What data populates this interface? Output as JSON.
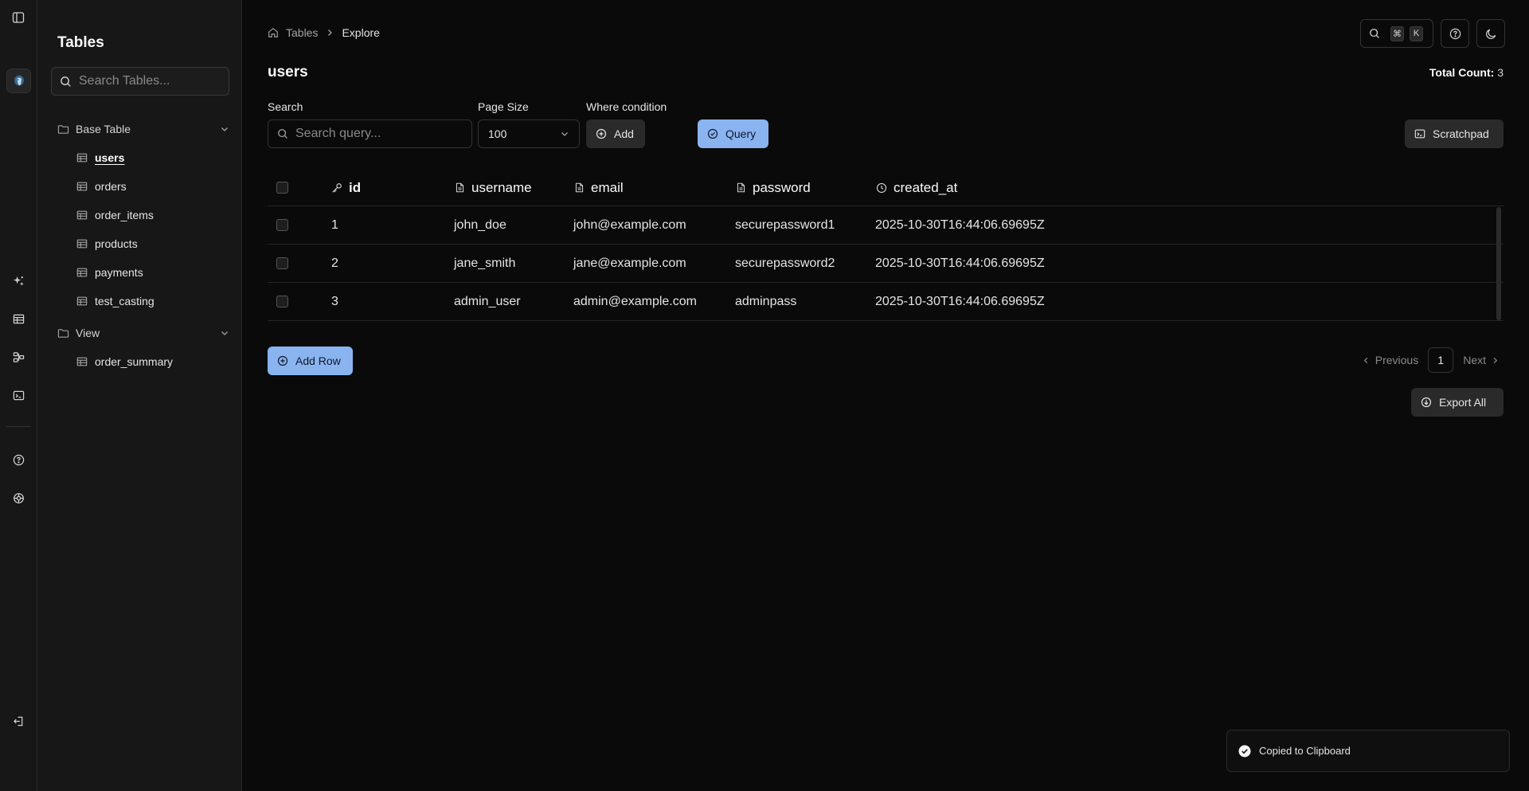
{
  "rail": {
    "icons": [
      "sidebar-toggle-icon",
      "database-logo",
      "sparkles-icon",
      "table-icon",
      "schema-icon",
      "terminal-icon",
      "help-icon",
      "settings-icon",
      "logout-icon"
    ]
  },
  "sidebar": {
    "title": "Tables",
    "search_placeholder": "Search Tables...",
    "groups": [
      {
        "label": "Base Table",
        "items": [
          "users",
          "orders",
          "order_items",
          "products",
          "payments",
          "test_casting"
        ]
      },
      {
        "label": "View",
        "items": [
          "order_summary"
        ]
      }
    ],
    "active_item": "users"
  },
  "breadcrumb": {
    "home": "Tables",
    "current": "Explore"
  },
  "header": {
    "shortcut_keys": [
      "⌘",
      "K"
    ],
    "page_title": "users",
    "total_label": "Total Count:",
    "total_value": "3"
  },
  "filters": {
    "search_label": "Search",
    "search_placeholder": "Search query...",
    "page_size_label": "Page Size",
    "page_size_value": "100",
    "where_label": "Where condition",
    "add_label": "Add",
    "query_label": "Query",
    "scratchpad_label": "Scratchpad"
  },
  "table": {
    "columns": [
      {
        "name": "id",
        "icon": "key-icon"
      },
      {
        "name": "username",
        "icon": "file-icon"
      },
      {
        "name": "email",
        "icon": "file-icon"
      },
      {
        "name": "password",
        "icon": "file-icon"
      },
      {
        "name": "created_at",
        "icon": "clock-icon"
      }
    ],
    "rows": [
      [
        "1",
        "john_doe",
        "john@example.com",
        "securepassword1",
        "2025-10-30T16:44:06.69695Z"
      ],
      [
        "2",
        "jane_smith",
        "jane@example.com",
        "securepassword2",
        "2025-10-30T16:44:06.69695Z"
      ],
      [
        "3",
        "admin_user",
        "admin@example.com",
        "adminpass",
        "2025-10-30T16:44:06.69695Z"
      ]
    ]
  },
  "actions": {
    "add_row": "Add Row",
    "export_all": "Export All"
  },
  "pagination": {
    "previous": "Previous",
    "page": "1",
    "next": "Next"
  },
  "toast": {
    "message": "Copied to Clipboard"
  },
  "colors": {
    "accent": "#8ab4f0",
    "background": "#0a0a0a",
    "sidebar": "#171717"
  }
}
